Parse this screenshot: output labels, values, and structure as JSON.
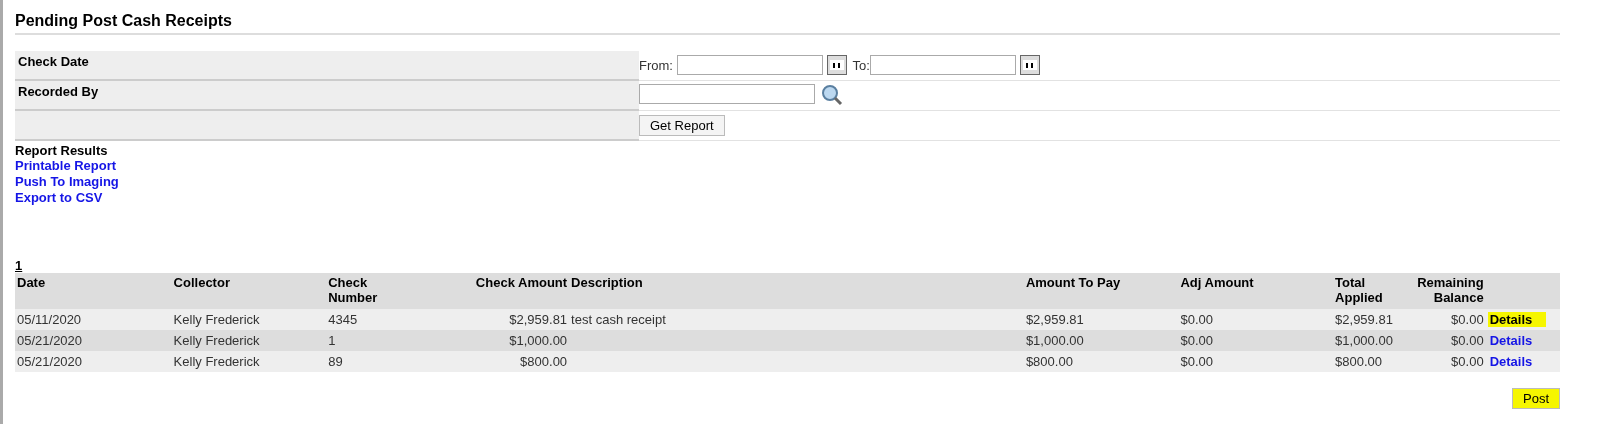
{
  "title": "Pending Post Cash Receipts",
  "filters": [
    {
      "kind": "daterange",
      "label": "Check Date",
      "from_label": "From:",
      "to_label": "To:"
    },
    {
      "kind": "lookup",
      "label": "Recorded By"
    },
    {
      "kind": "action",
      "button": "Get Report"
    }
  ],
  "report": {
    "heading": "Report Results",
    "links": [
      "Printable Report",
      "Push To Imaging",
      "Export to CSV"
    ]
  },
  "pages": [
    {
      "label": "1",
      "selected": true
    }
  ],
  "table": {
    "columns": [
      "Date",
      "Collector",
      "Check Number",
      "Check Amount",
      "Description",
      "Amount To Pay",
      "Adj Amount",
      "Total Applied",
      "Remaining Balance"
    ],
    "rows": [
      {
        "cells": [
          "05/11/2020",
          "Kelly Frederick",
          "4345",
          "$2,959.81",
          "test cash receipt",
          "$2,959.81",
          "$0.00",
          "$2,959.81",
          "$0.00"
        ],
        "action": "Details",
        "highlighted": true
      },
      {
        "cells": [
          "05/21/2020",
          "Kelly Frederick",
          "1",
          "$1,000.00",
          "",
          "$1,000.00",
          "$0.00",
          "$1,000.00",
          "$0.00"
        ],
        "action": "Details",
        "highlighted": false
      },
      {
        "cells": [
          "05/21/2020",
          "Kelly Frederick",
          "89",
          "$800.00",
          "",
          "$800.00",
          "$0.00",
          "$800.00",
          "$0.00"
        ],
        "action": "Details",
        "highlighted": false
      }
    ]
  },
  "post_button": {
    "label": "Post",
    "highlighted": true
  }
}
